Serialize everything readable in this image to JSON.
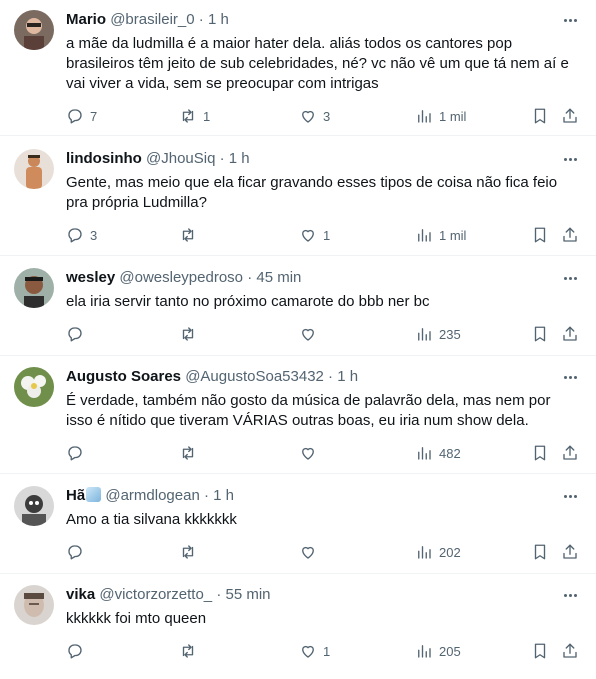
{
  "tweets": [
    {
      "name": "Mario",
      "handle": "@brasileir_0",
      "time": "1 h",
      "text": "a mãe da ludmilla é a maior hater dela. aliás todos os cantores pop\nbrasileiros têm jeito de sub celebridades, né? vc não vê um que tá nem aí e\nvai viver a vida, sem se preocupar com intrigas",
      "replies": "7",
      "retweets": "1",
      "likes": "3",
      "views": "1 mil"
    },
    {
      "name": "lindosinho",
      "handle": "@JhouSiq",
      "time": "1 h",
      "text": "Gente, mas meio que ela ficar gravando esses tipos de coisa não fica feio\npra própria Ludmilla?",
      "replies": "3",
      "retweets": "",
      "likes": "1",
      "views": "1 mil"
    },
    {
      "name": "wesley",
      "handle": "@owesleypedroso",
      "time": "45 min",
      "text": "ela iria servir tanto no próximo camarote do bbb ner bc",
      "replies": "",
      "retweets": "",
      "likes": "",
      "views": "235"
    },
    {
      "name": "Augusto Soares",
      "handle": "@AugustoSoa53432",
      "time": "1 h",
      "text": "É verdade, também não gosto da música de palavrão dela, mas nem por\nisso é nítido que tiveram VÁRIAS outras boas, eu iria num show dela.",
      "replies": "",
      "retweets": "",
      "likes": "",
      "views": "482"
    },
    {
      "name": "Hã",
      "handle": "@armdlogean",
      "time": "1 h",
      "text": "Amo a tia silvana kkkkkkk",
      "replies": "",
      "retweets": "",
      "likes": "",
      "views": "202"
    },
    {
      "name": "vika",
      "handle": "@victorzorzetto_",
      "time": "55 min",
      "text": "kkkkkk foi mto queen",
      "replies": "",
      "retweets": "",
      "likes": "1",
      "views": "205"
    }
  ],
  "dot": "·",
  "icons": [
    "reply-icon",
    "retweet-icon",
    "like-icon",
    "views-icon",
    "bookmark-icon",
    "share-icon",
    "more-icon"
  ]
}
